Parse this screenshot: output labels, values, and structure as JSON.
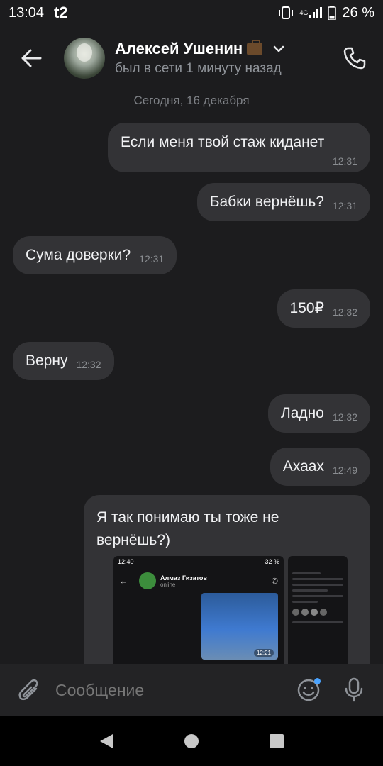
{
  "statusbar": {
    "time": "13:04",
    "carrier": "t2",
    "network": "4G",
    "battery": "26 %",
    "icons": [
      "vibrate-icon",
      "signal-icon",
      "battery-icon"
    ]
  },
  "header": {
    "name": "Алексей Ушенин",
    "name_emoji": "briefcase-emoji",
    "status": "был в сети 1 минуту назад"
  },
  "chat": {
    "date_separator": "Сегодня, 16 декабря",
    "messages": [
      {
        "text": "Если меня твой стаж киданет",
        "time": "12:31",
        "side": "out"
      },
      {
        "text": "Бабки вернёшь?",
        "time": "12:31",
        "side": "out"
      },
      {
        "text": "Сума доверки?",
        "time": "12:31",
        "side": "in"
      },
      {
        "text": "150₽",
        "time": "12:32",
        "side": "out"
      },
      {
        "text": "Верну",
        "time": "12:32",
        "side": "in"
      },
      {
        "text": "Ладно",
        "time": "12:32",
        "side": "out"
      },
      {
        "text": "Ахаах",
        "time": "12:49",
        "side": "out"
      },
      {
        "text": "Я так понимаю ты тоже не вернёшь?)",
        "time": "",
        "side": "out"
      }
    ],
    "attachment_1": {
      "status_time": "12:40",
      "status_battery": "32 %",
      "contact_name": "Алмаз Гизатов",
      "contact_status": "online",
      "image_time": "12:21"
    }
  },
  "composer": {
    "placeholder": "Сообщение"
  },
  "colors": {
    "background": "#1c1c1e",
    "bubble": "#333336",
    "accent": "#4aa3ff"
  }
}
